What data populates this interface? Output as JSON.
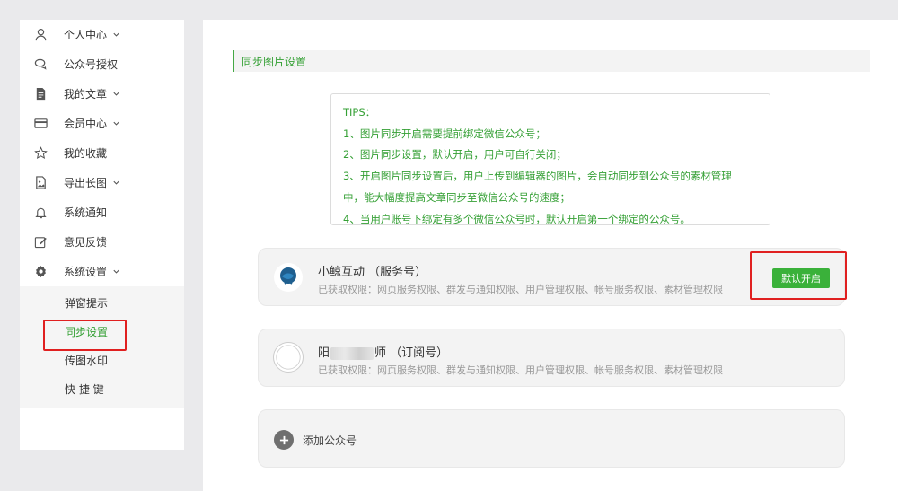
{
  "sidebar": {
    "items": [
      {
        "label": "个人中心",
        "icon": "user-icon",
        "has_chevron": true
      },
      {
        "label": "公众号授权",
        "icon": "chat-bubbles-icon",
        "has_chevron": false
      },
      {
        "label": "我的文章",
        "icon": "document-icon",
        "has_chevron": true
      },
      {
        "label": "会员中心",
        "icon": "card-icon",
        "has_chevron": true
      },
      {
        "label": "我的收藏",
        "icon": "star-icon",
        "has_chevron": false
      },
      {
        "label": "导出长图",
        "icon": "image-icon",
        "has_chevron": true
      },
      {
        "label": "系统通知",
        "icon": "bell-icon",
        "has_chevron": false
      },
      {
        "label": "意见反馈",
        "icon": "edit-icon",
        "has_chevron": false
      },
      {
        "label": "系统设置",
        "icon": "gear-icon",
        "has_chevron": true
      }
    ],
    "submenu": [
      {
        "label": "弹窗提示"
      },
      {
        "label": "同步设置"
      },
      {
        "label": "传图水印"
      },
      {
        "label": "快 捷 键"
      }
    ],
    "active_sub": "同步设置"
  },
  "main": {
    "section_title": "同步图片设置",
    "tips": {
      "heading": "TIPS：",
      "lines": [
        "1、图片同步开启需要提前绑定微信公众号；",
        "2、图片同步设置，默认开启，用户可自行关闭；",
        "3、开启图片同步设置后，用户上传到编辑器的图片，会自动同步到公众号的素材管理",
        "中，能大幅度提高文章同步至微信公众号的速度；",
        "4、当用户账号下绑定有多个微信公众号时，默认开启第一个绑定的公众号。"
      ]
    },
    "accounts": [
      {
        "name": "小鲸互动 （服务号）",
        "perms": "已获取权限：网页服务权限、群发与通知权限、用户管理权限、帐号服务权限、素材管理权限",
        "button": "默认开启"
      },
      {
        "name_prefix": "阳",
        "name_suffix": "师 （订阅号）",
        "perms": "已获取权限：网页服务权限、群发与通知权限、用户管理权限、帐号服务权限、素材管理权限"
      }
    ],
    "add_label": "添加公众号"
  },
  "colors": {
    "accent": "#35a035",
    "highlight": "#e02020",
    "page_bg": "#eaeaec"
  }
}
